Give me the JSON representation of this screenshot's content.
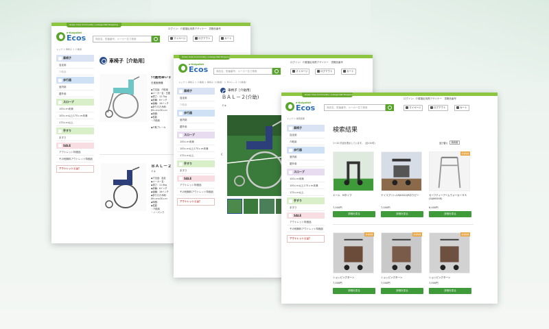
{
  "site": {
    "community": "Green Care Community / e-Kaigo Net Shopping",
    "logo_sub": "e-KaigoNet",
    "logo_main": "Ecos",
    "search_placeholder": "商品名、型番番号、メーカー名で検索",
    "login_text": "ログイン：介護福祉用具デザイナー　書籍品番号",
    "mypage": "マイページ",
    "logout": "ログアウト",
    "cart": "カート",
    "brand_color": "#59a52c"
  },
  "sidebar": {
    "categories": [
      {
        "label": "車椅子",
        "color": "blue",
        "items": [
          "自走用",
          "介助用"
        ]
      },
      {
        "label": "歩行器",
        "color": "blue2",
        "items": [
          "室内用",
          "屋外用"
        ]
      },
      {
        "label": "スロープ",
        "color": "purple",
        "items": [
          "100ｃｍ未満",
          "100ｃｍ以上175ｃｍ未満",
          "175ｃｍ以上"
        ]
      },
      {
        "label": "手すり",
        "color": "green",
        "items": [
          "手すり"
        ]
      },
      {
        "label": "SALE",
        "color": "pink",
        "items": [
          "アウトレット特価品",
          "その他無料アウトレット特価品"
        ]
      }
    ],
    "outlet": "アウトレットとは？"
  },
  "win1": {
    "breadcrumb": "トップ ＞ 車椅子 ＞ 介助用",
    "page_title": "車椅子［介助用］",
    "products": [
      {
        "name": "介護用車いす",
        "maker": "日進医療器",
        "spec": "◆寸法品：介助用\n◆メーカー名：日進\n◆重さ：12.7kg\n◆前輪：6インチ\n◆後輪：16インチ\n◆折りたたみ時：\n69ｃｍ×30ｃｍ\n◆特徴：\n◆性能\n・介助用\n\n◆介助ブレーキ"
      },
      {
        "name": "ＢＡＬ－２",
        "maker": "ミキ",
        "spec": "◆寸法品：自走\n◆メーカー名：\n◆重さ：11.9kg\n◆前輪：6インチ\n◆後輪：16インチ\n◆折りたたみ時：\n69ｃｍ×30ｃｍ\n◆特徴：\n◆性能\n・介助用\n・ノーパンク"
      }
    ]
  },
  "win2": {
    "breadcrumb": "トップ ＞ 車椅子 ＞ 介助用 ＞ 車椅子［介助用］ ＞ ＢＡＬ－２［介助用］",
    "category_label": "車椅子［介助用］",
    "product_title": "ＢＡＬ－２(介助)",
    "maker": "ミキ"
  },
  "win3": {
    "breadcrumb": "トップ ＞ 検索結果",
    "result_title": "検索結果",
    "hits": "1～20 件目を表示しています。（全120件）",
    "sort_label": "並び替え",
    "sort_value": "新着順",
    "new_badge": "新着情報",
    "detail_button": "詳細を見る",
    "products": [
      {
        "name": "エール　Mタイプ",
        "price": "7,000円",
        "new": false
      },
      {
        "name": "テイコブリトルR(KG20)Rおりピー",
        "price": "7,000円",
        "new": false
      },
      {
        "name": "セーフティーアームウォーカーＳＳ(SAM05SR)",
        "price": "6,000円",
        "new": true
      },
      {
        "name": "ショッピングターン",
        "price": "7,000円",
        "new": true
      },
      {
        "name": "ショッピングターン",
        "price": "7,000円",
        "new": true
      },
      {
        "name": "ショッピングターン",
        "price": "7,000円",
        "new": true
      }
    ]
  }
}
